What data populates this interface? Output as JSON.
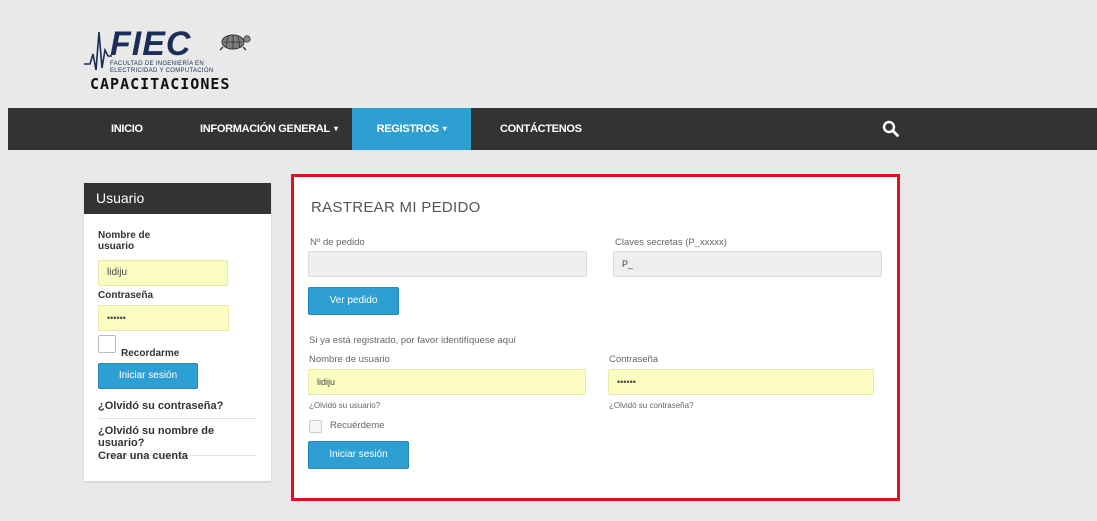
{
  "logo": {
    "brand": "FIEC",
    "subtitle_line1": "Facultad de Ingeniería en",
    "subtitle_line2": "Electricidad y Computación",
    "tagline": "CAPACITACIONES"
  },
  "nav": {
    "items": [
      {
        "label": "INICIO"
      },
      {
        "label": "INFORMACIÓN GENERAL",
        "caret": "▾"
      },
      {
        "label": "REGISTROS",
        "caret": "▾",
        "active": true
      },
      {
        "label": "CONTÁCTENOS"
      }
    ],
    "search_icon": "search-icon"
  },
  "sidebar": {
    "title": "Usuario",
    "username_label_line1": "Nombre de",
    "username_label_line2": "usuario",
    "username_value": "lidiju",
    "password_label": "Contraseña",
    "password_value": "••••••",
    "remember_label": "Recordarme",
    "login_button": "Iniciar sesión",
    "links": [
      "¿Olvidó su contraseña?",
      "¿Olvidó su nombre de usuario?",
      "Crear una cuenta"
    ]
  },
  "main": {
    "title": "RASTREAR MI PEDIDO",
    "order_label": "Nº de pedido",
    "order_value": "",
    "secret_label": "Claves secretas (P_xxxxx)",
    "secret_value": "P_",
    "view_order_button": "Ver pedido",
    "registered_text": "Si ya está registrado, por favor identifíquese aquí",
    "username_label": "Nombre de usuario",
    "username_value": "lidiju",
    "password_label": "Contraseña",
    "password_value": "••••••",
    "forgot_user": "¿Olvidó su usuario?",
    "forgot_password": "¿Olvidó su contraseña?",
    "remember_label": "Recuérdeme",
    "login_button": "Iniciar sesión"
  },
  "colors": {
    "nav_bg": "#333333",
    "accent": "#2e9fd2",
    "highlight_border": "#e3101d",
    "autofill": "#fbfdc1"
  }
}
